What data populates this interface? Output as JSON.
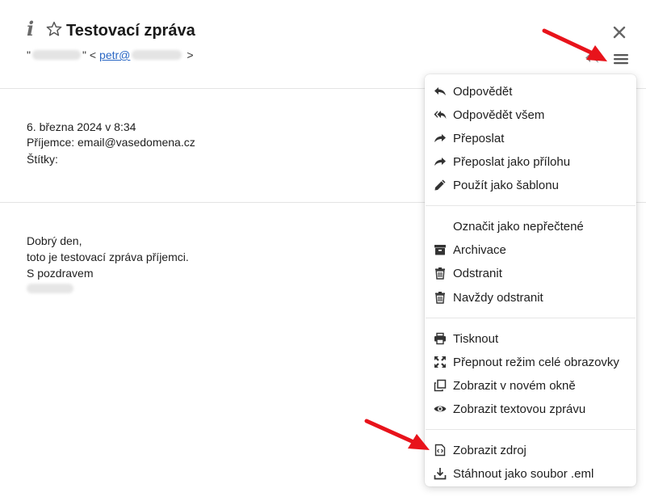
{
  "header": {
    "info_icon_glyph": "i",
    "subject": "Testovací zpráva",
    "sender_quote_open": "\"",
    "sender_quote_close": "\" <",
    "sender_email_prefix": "petr@",
    "sender_email_close": ">"
  },
  "meta": {
    "date": "6. března 2024 v 8:34",
    "recipient": "Příjemce: email@vasedomena.cz",
    "labels": "Štítky:"
  },
  "body": {
    "line1": "Dobrý den,",
    "line2": "toto je testovací zpráva příjemci.",
    "line3": "S pozdravem"
  },
  "menu": {
    "reply": "Odpovědět",
    "reply_all": "Odpovědět všem",
    "forward": "Přeposlat",
    "forward_attachment": "Přeposlat jako přílohu",
    "use_template": "Použít jako šablonu",
    "mark_unread": "Označit jako nepřečtené",
    "archive": "Archivace",
    "delete": "Odstranit",
    "delete_forever": "Navždy odstranit",
    "print": "Tisknout",
    "fullscreen": "Přepnout režim celé obrazovky",
    "new_window": "Zobrazit v novém okně",
    "text_view": "Zobrazit textovou zprávu",
    "view_source": "Zobrazit zdroj",
    "download_eml": "Stáhnout jako soubor .eml"
  },
  "colors": {
    "arrow": "#e8131b",
    "link": "#2a67c4",
    "icon": "#333333"
  }
}
